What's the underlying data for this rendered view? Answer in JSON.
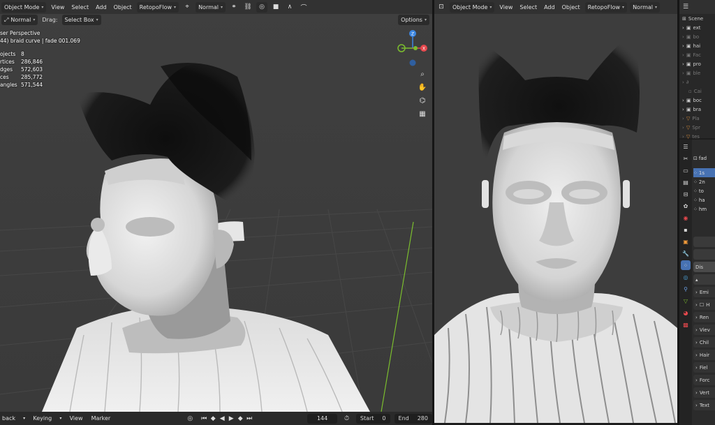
{
  "left_viewport": {
    "header": {
      "mode": "Object Mode",
      "menus": [
        "View",
        "Select",
        "Add",
        "Object"
      ],
      "addon": "RetopoFlow",
      "orientation": "Normal"
    },
    "subheader": {
      "transform": "Normal",
      "drag_label": "Drag:",
      "drag_value": "Select Box",
      "options": "Options"
    },
    "overlay": {
      "view_name": "ser Perspective",
      "object_info": "44) braid curve | fade 001.069"
    },
    "stats": [
      {
        "k": "ojects",
        "v": "8"
      },
      {
        "k": "rtices",
        "v": "286,846"
      },
      {
        "k": "dges",
        "v": "572,603"
      },
      {
        "k": "ces",
        "v": "285,772"
      },
      {
        "k": "angles",
        "v": "571,544"
      }
    ],
    "gizmo": {
      "x": "X",
      "y": "Y",
      "z": "Z"
    }
  },
  "right_viewport": {
    "header": {
      "mode": "Object Mode",
      "menus": [
        "View",
        "Select",
        "Add",
        "Object"
      ],
      "addon": "RetopoFlow",
      "orientation": "Normal"
    }
  },
  "timeline": {
    "playback": "back",
    "keying": "Keying",
    "view": "View",
    "marker": "Marker",
    "current_frame": "144",
    "start_label": "Start",
    "start_value": "0",
    "end_label": "End",
    "end_value": "280"
  },
  "outliner": {
    "title": "Scene",
    "rows": [
      {
        "label": "ext",
        "dim": false
      },
      {
        "label": "bo",
        "dim": true
      },
      {
        "label": "hai",
        "dim": false
      },
      {
        "label": "Fac",
        "dim": true
      },
      {
        "label": "pro",
        "dim": false
      },
      {
        "label": "ble",
        "dim": true
      },
      {
        "label": "",
        "dim": true
      },
      {
        "label": "Cai",
        "dim": true
      },
      {
        "label": "boc",
        "dim": false
      },
      {
        "label": "bra",
        "dim": false
      },
      {
        "label": "Pla",
        "dim": true
      },
      {
        "label": "Spr",
        "dim": true
      },
      {
        "label": "tes",
        "dim": true
      }
    ]
  },
  "properties": {
    "object_name": "fad",
    "list": [
      "1s",
      "2n",
      "to",
      "ha",
      "hm"
    ],
    "panels": [
      "Emi",
      "H",
      "Ren",
      "Viev",
      "Chil",
      "Hair",
      "Fiel",
      "Forc",
      "Vert",
      "Text"
    ],
    "button": "Dis"
  },
  "colors": {
    "accent": "#4772b3",
    "viewport_bg": "#3d3d3d",
    "x_axis": "#e5484d",
    "y_axis": "#7bbd2e",
    "z_axis": "#3c86e0"
  }
}
